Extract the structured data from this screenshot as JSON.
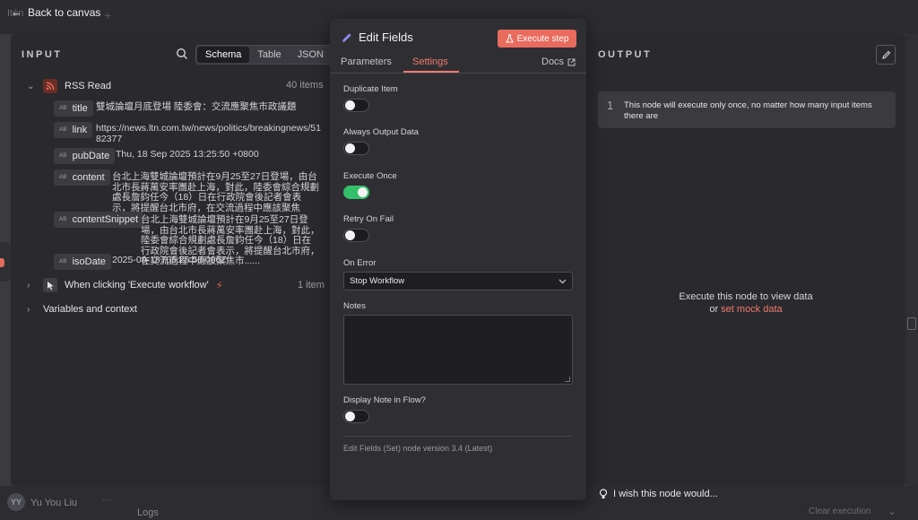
{
  "header": {
    "back_label": "Back to canvas",
    "bg_tab_label": "Itén"
  },
  "input": {
    "title": "INPUT",
    "view_tabs": [
      "Schema",
      "Table",
      "JSON"
    ],
    "active_view": "Schema",
    "rss_node": {
      "label": "RSS Read",
      "count": "40 items"
    },
    "fields": [
      {
        "name": "title",
        "value": "雙城論壇月底登場 陸委會：交流應聚焦市政議題"
      },
      {
        "name": "link",
        "value": "https://news.ltn.com.tw/news/politics/breakingnews/5182377"
      },
      {
        "name": "pubDate",
        "value": "Thu, 18 Sep 2025 13:25:50 +0800"
      },
      {
        "name": "content",
        "value": "台北上海雙城論壇預計在9月25至27日登場，由台北市長蔣萬安率團赴上海，對此，陸委會綜合規劃處長詹鈞任今（18）日在行政院會後記者會表示，將提醒台北市府，在交流過程中應該聚焦市......"
      },
      {
        "name": "contentSnippet",
        "value": "台北上海雙城論壇預計在9月25至27日登場，由台北市長蔣萬安率團赴上海，對此，陸委會綜合規劃處長詹鈞任今（18）日在行政院會後記者會表示，將提醒台北市府，在交流過程中應該聚焦市......"
      },
      {
        "name": "isoDate",
        "value": "2025-09-18T05:25:50.000Z"
      }
    ],
    "trigger_node": {
      "label": "When clicking 'Execute workflow'",
      "count": "1 item"
    },
    "variables_label": "Variables and context"
  },
  "modal": {
    "title": "Edit Fields",
    "execute_label": "Execute step",
    "tabs": [
      "Parameters",
      "Settings"
    ],
    "active_tab": "Settings",
    "docs_label": "Docs",
    "settings": {
      "duplicate_item": {
        "label": "Duplicate Item",
        "on": false
      },
      "always_output": {
        "label": "Always Output Data",
        "on": false
      },
      "execute_once": {
        "label": "Execute Once",
        "on": true
      },
      "retry_on_fail": {
        "label": "Retry On Fail",
        "on": false
      },
      "on_error": {
        "label": "On Error",
        "value": "Stop Workflow"
      },
      "notes": {
        "label": "Notes",
        "value": ""
      },
      "display_note": {
        "label": "Display Note in Flow?",
        "on": false
      }
    },
    "version": "Edit Fields (Set) node version 3.4 (Latest)"
  },
  "output": {
    "title": "OUTPUT",
    "notice_number": "1",
    "notice_text": "This node will execute only once, no matter how many input items there are",
    "empty_line1": "Execute this node to view data",
    "empty_or": "or",
    "empty_link": "set mock data"
  },
  "footer": {
    "avatar_initials": "YY",
    "user_name": "Yu You Liu",
    "user_menu": "···",
    "logs_label": "Logs",
    "wish_text": "I wish this node would...",
    "clear_label": "Clear execution"
  },
  "colors": {
    "accent": "#ef7a6c",
    "execute_button": "#e86b5e",
    "toggle_on": "#34c06a"
  }
}
